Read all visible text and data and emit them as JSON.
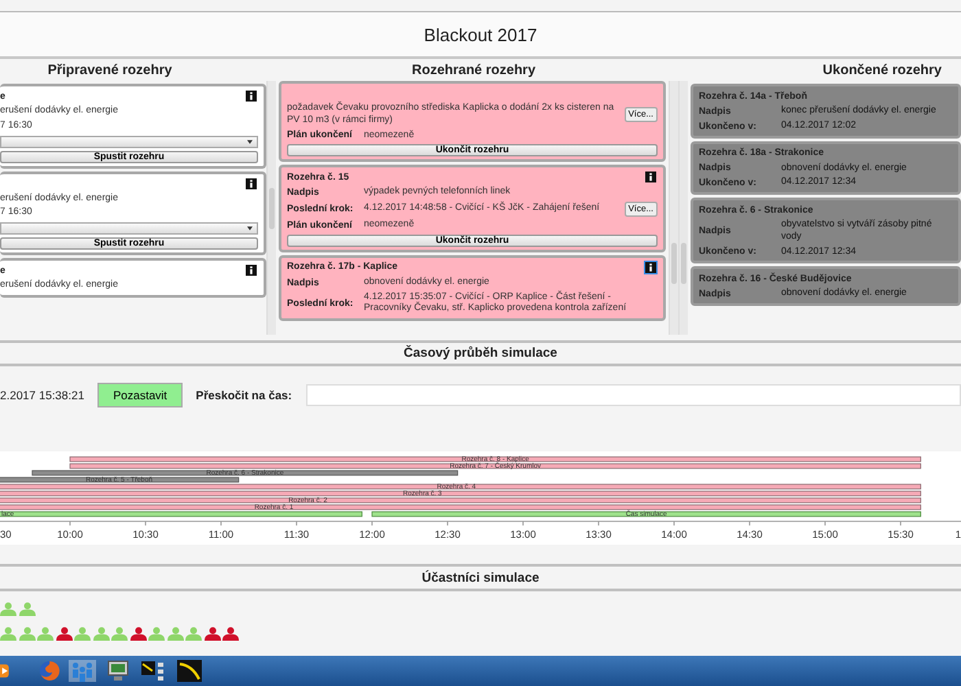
{
  "window": {
    "title": "Blackout 2017"
  },
  "columns": [
    {
      "title": "Připravené rozehry",
      "kind": "prepared",
      "cards": [
        {
          "title": "e",
          "info_icon": true,
          "focused": false,
          "rows": [
            {
              "value": "erušení dodávky el. energie"
            },
            {
              "value": "7 16:30"
            }
          ],
          "dropdown": true,
          "button": "Spustit rozehru"
        },
        {
          "info_icon": true,
          "focused": false,
          "rows": [
            {
              "value": "erušení dodávky el. energie"
            },
            {
              "value": "7 16:30"
            }
          ],
          "dropdown": true,
          "button": "Spustit rozehru"
        },
        {
          "title": "e",
          "info_icon": true,
          "focused": false,
          "rows": [
            {
              "value": "erušení dodávky el. energie"
            }
          ]
        }
      ]
    },
    {
      "title": "Rozehrané rozehry",
      "kind": "running",
      "cards": [
        {
          "rows": [
            {
              "value": "požadavek Čevaku provozního střediska Kaplicka o dodání 2x ks cisteren na PV 10 m3 (v rámci firmy)",
              "action": "Více..."
            },
            {
              "label": "Plán ukončení",
              "value": "neomezeně"
            }
          ],
          "button": "Ukončit rozehru"
        },
        {
          "title": "Rozehra č. 15",
          "info_icon": true,
          "focused": false,
          "rows": [
            {
              "label": "Nadpis",
              "value": "výpadek pevných telefonních linek"
            },
            {
              "label": "Poslední krok:",
              "value": "4.12.2017 14:48:58 - Cvičící - KŠ JčK - Zahájení řešení",
              "action": "Více..."
            },
            {
              "label": "Plán ukončení",
              "value": "neomezeně"
            }
          ],
          "button": "Ukončit rozehru"
        },
        {
          "title": "Rozehra č. 17b - Kaplice",
          "info_icon": true,
          "focused": true,
          "rows": [
            {
              "label": "Nadpis",
              "value": "obnovení dodávky el. energie"
            },
            {
              "label": "Poslední krok:",
              "value": "4.12.2017 15:35:07 - Cvičící - ORP Kaplice - Část řešení - Pracovníky Čevaku, stř. Kaplicko provedena kontrola zařízení"
            }
          ]
        }
      ]
    },
    {
      "title": "Ukončené rozehry",
      "kind": "finished",
      "cards": [
        {
          "title": "Rozehra č. 14a - Třeboň",
          "rows": [
            {
              "label": "Nadpis",
              "value": "konec přerušení dodávky el. energie"
            },
            {
              "label": "Ukončeno v:",
              "value": "04.12.2017 12:02"
            }
          ]
        },
        {
          "title": "Rozehra č. 18a - Strakonice",
          "rows": [
            {
              "label": "Nadpis",
              "value": "obnovení dodávky el. energie"
            },
            {
              "label": "Ukončeno v:",
              "value": "04.12.2017 12:34"
            }
          ]
        },
        {
          "title": "Rozehra č. 6 - Strakonice",
          "rows": [
            {
              "label": "Nadpis",
              "value": "obyvatelstvo si vytváří zásoby pitné vody"
            },
            {
              "label": "Ukončeno v:",
              "value": "04.12.2017 12:34"
            }
          ]
        },
        {
          "title": "Rozehra č. 16 - České Budějovice",
          "rows": [
            {
              "label": "Nadpis",
              "value": "obnovení dodávky el. energie"
            }
          ]
        }
      ]
    }
  ],
  "simulation": {
    "title": "Časový průběh simulace",
    "clock": "2.2017 15:38:21",
    "pause_button": "Pozastavit",
    "jump_label": "Přeskočit na čas:"
  },
  "timeline": {
    "ticks": [
      "30",
      "10:00",
      "10:30",
      "11:00",
      "11:30",
      "12:00",
      "12:30",
      "13:00",
      "13:30",
      "14:00",
      "14:30",
      "15:00",
      "15:30",
      "1"
    ],
    "rows": [
      {
        "kind": "running",
        "bars": [
          {
            "label": "Rozehra č. 8 - Kaplice"
          }
        ]
      },
      {
        "kind": "running",
        "bars": [
          {
            "label": "Rozehra č. 7 - Český Krumlov"
          }
        ]
      },
      {
        "kind": "finished",
        "bars": [
          {
            "label": "Rozehra č. 6 - Strakonice"
          }
        ]
      },
      {
        "kind": "finished",
        "bars": [
          {
            "label": "Rozehra č. 5 - Třeboň"
          }
        ]
      },
      {
        "kind": "running",
        "bars": [
          {
            "label": "Rozehra č. 4"
          }
        ]
      },
      {
        "kind": "running",
        "bars": [
          {
            "label": "Rozehra č. 3"
          }
        ]
      },
      {
        "kind": "running",
        "bars": [
          {
            "label": "Rozehra č. 2"
          }
        ]
      },
      {
        "kind": "running",
        "bars": [
          {
            "label": "Rozehra č. 1"
          }
        ]
      },
      {
        "kind": "simulation",
        "bars": [
          {
            "label": "lace"
          },
          {
            "label": "Čas simulace"
          }
        ]
      }
    ]
  },
  "participants": {
    "title": "Účastníci simulace",
    "rows": [
      [
        {
          "color": "#8fd66a"
        },
        {
          "color": "#8fd66a"
        }
      ],
      [
        {
          "color": "#8fd66a"
        },
        {
          "color": "#8fd66a"
        },
        {
          "color": "#8fd66a"
        },
        {
          "color": "#d0102a"
        },
        {
          "color": "#8fd66a"
        },
        {
          "color": "#8fd66a"
        },
        {
          "color": "#8fd66a"
        },
        {
          "color": "#d0102a"
        },
        {
          "color": "#8fd66a"
        },
        {
          "color": "#8fd66a"
        },
        {
          "color": "#8fd66a"
        },
        {
          "color": "#d0102a"
        },
        {
          "color": "#d0102a"
        }
      ]
    ]
  }
}
